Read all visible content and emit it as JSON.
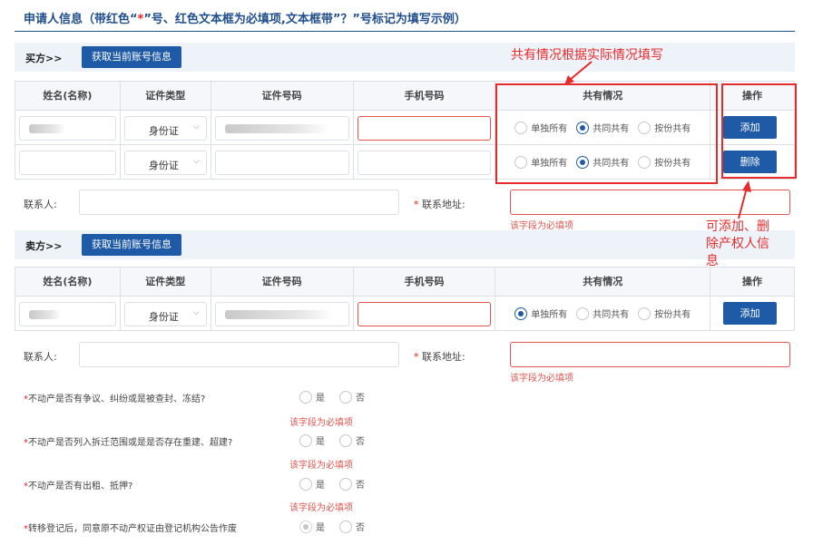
{
  "header": {
    "title": "申请人信息（带红色“",
    "title_star": "*",
    "title_rest": "”号、红色文本框为必填项,文本框带”？”号标记为填写示例）"
  },
  "buyer": {
    "label": "买方>>",
    "fetch_button": "获取当前账号信息"
  },
  "seller": {
    "label": "卖方>>",
    "fetch_button": "获取当前账号信息"
  },
  "table": {
    "columns": [
      "姓名(名称)",
      "证件类型",
      "证件号码",
      "手机号码",
      "共有情况",
      "操作"
    ]
  },
  "ownership_options": [
    "单独所有",
    "共同共有",
    "按份共有"
  ],
  "rows": {
    "buyer_1": {
      "id_type": "身份证",
      "action": "添加"
    },
    "buyer_2": {
      "id_type": "身份证",
      "action": "删除"
    },
    "seller_1": {
      "id_type": "身份证",
      "action": "添加"
    }
  },
  "contact": {
    "contact_label": "联系人:",
    "address_star": "*",
    "address_label": " 联系地址:",
    "required_msg": "该字段为必填项"
  },
  "questions": [
    {
      "star": "*",
      "text": "不动产是否有争议、纠纷或是被查封、冻结?",
      "yes": "是",
      "no": "否",
      "error": "该字段为必填项"
    },
    {
      "star": "*",
      "text": "不动产是否列入拆迁范围或是是否存在重建、超建?",
      "yes": "是",
      "no": "否",
      "error": "该字段为必填项"
    },
    {
      "star": "*",
      "text": "不动产是否有出租、抵押?",
      "yes": "是",
      "no": "否",
      "error": "该字段为必填项"
    },
    {
      "star": "*",
      "text": "转移登记后，同意原不动产权证由登记机构公告作废",
      "yes": "是",
      "no": "否"
    }
  ],
  "annotations": {
    "ownership_note": "共有情况根据实际情况填写",
    "action_note_line1": "可添加、删",
    "action_note_line2": "除产权人信",
    "action_note_line3": "息"
  },
  "colors": {
    "primary": "#1f5aa6",
    "title_blue": "#1f4e8c",
    "error_red": "#e0554f",
    "annotation_red": "#e52b2b"
  }
}
